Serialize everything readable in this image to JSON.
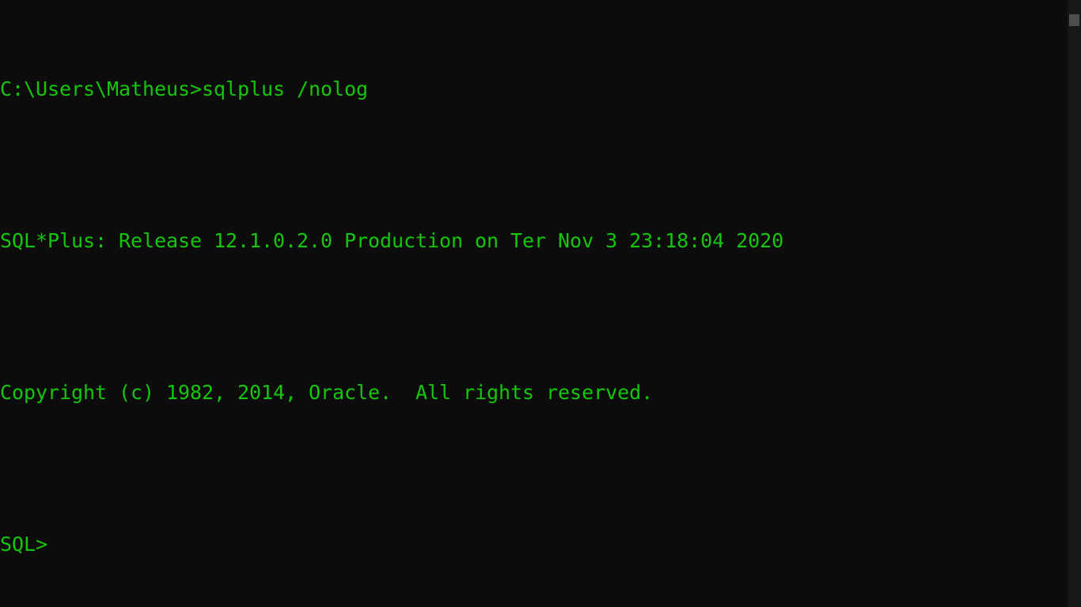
{
  "terminal": {
    "lines": [
      "C:\\Users\\Matheus>sqlplus /nolog",
      "",
      "SQL*Plus: Release 12.1.0.2.0 Production on Ter Nov 3 23:18:04 2020",
      "",
      "Copyright (c) 1982, 2014, Oracle.  All rights reserved.",
      "",
      "SQL>"
    ]
  },
  "colors": {
    "background": "#0c0c0c",
    "text": "#16c60c",
    "scrollbar_track": "#171717",
    "scrollbar_thumb": "#4d4d4d"
  }
}
